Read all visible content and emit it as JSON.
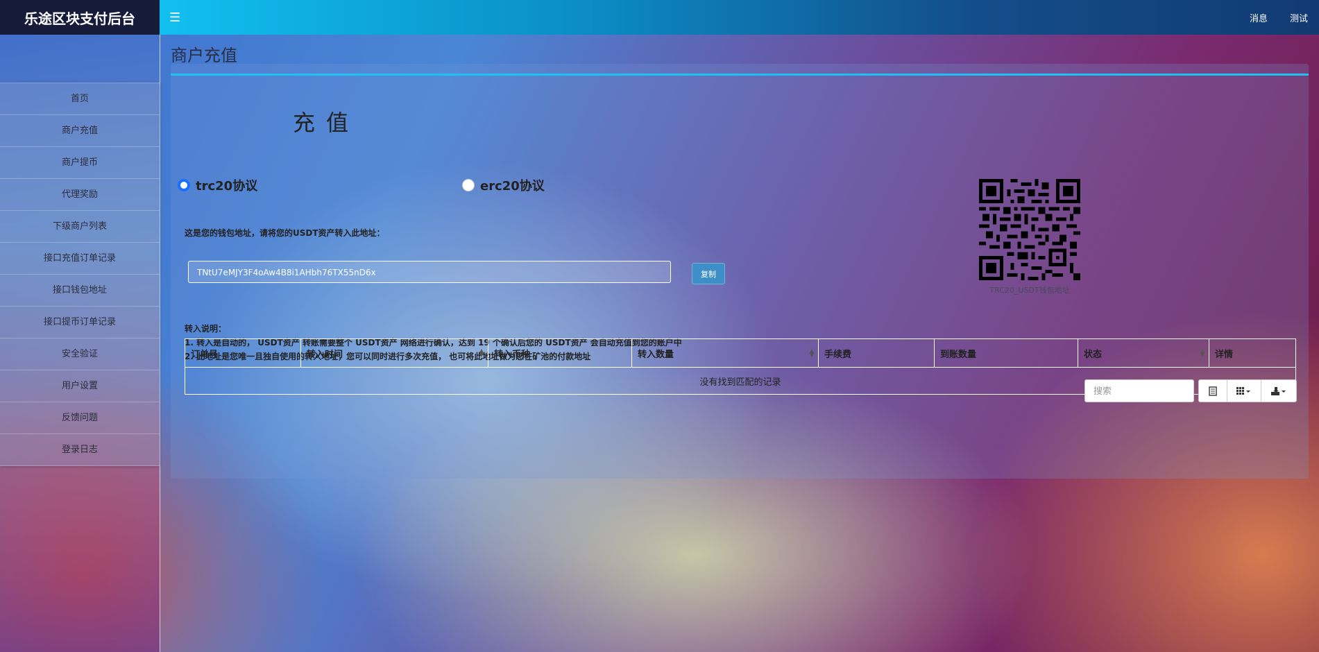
{
  "header": {
    "brand": "乐途区块支付后台",
    "menu_icon": "☰",
    "links": [
      "消息",
      "测试"
    ]
  },
  "sidebar": {
    "items": [
      "首页",
      "商户充值",
      "商户提币",
      "代理奖励",
      "下级商户列表",
      "接口充值订单记录",
      "接口钱包地址",
      "接口提币订单记录",
      "安全验证",
      "用户设置",
      "反馈问题",
      "登录日志"
    ]
  },
  "page": {
    "title": "商户充值",
    "heading": "充值",
    "protocols": [
      {
        "label": "trc20协议",
        "checked": true
      },
      {
        "label": "erc20协议",
        "checked": false
      }
    ],
    "wallet_label": "这是您的钱包地址，请将您的USDT资产转入此地址：",
    "address": "TNtU7eMJY3F4oAw4B8i1AHbh76TX55nD6x",
    "copy_label": "复制",
    "qr_caption": "TRC20_USDT钱包地址",
    "notes_title": "转入说明：",
    "notes": [
      "1. 转入是自动的， USDT资产 转账需要整个 USDT资产 网络进行确认，达到 19 个确认后您的 USDT资产 会自动充值到您的账户中",
      "2. 此地址是您唯一且独自使用的转入地址，您可以同时进行多次充值， 也可将此地址做为您在矿池的付款地址"
    ]
  },
  "table": {
    "search_placeholder": "搜索",
    "toolbar_icons": [
      "list-view-icon",
      "columns-icon",
      "export-icon"
    ],
    "columns": [
      "订单号",
      "转入时间",
      "转入币种",
      "转入数量",
      "手续费",
      "到账数量",
      "状态",
      "详情"
    ],
    "empty_text": "没有找到匹配的记录"
  }
}
